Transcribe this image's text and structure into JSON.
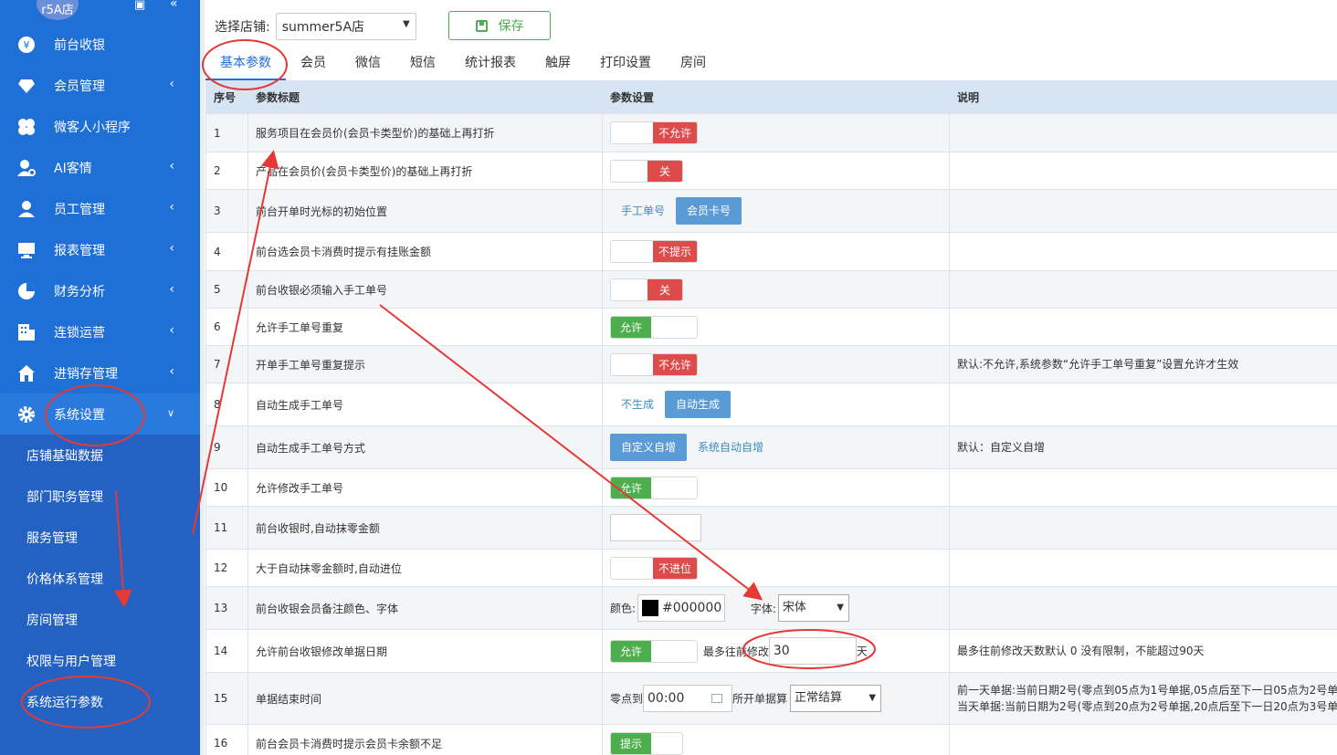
{
  "sidebar": {
    "store_badge": "r5A店",
    "menu": [
      {
        "label": "前台收银",
        "icon": "yen-icon"
      },
      {
        "label": "会员管理",
        "icon": "diamond-icon"
      },
      {
        "label": "微客人小程序",
        "icon": "flower-icon"
      },
      {
        "label": "AI客情",
        "icon": "user-ai-icon"
      },
      {
        "label": "员工管理",
        "icon": "user-icon"
      },
      {
        "label": "报表管理",
        "icon": "monitor-icon"
      },
      {
        "label": "财务分析",
        "icon": "pie-icon"
      },
      {
        "label": "连锁运营",
        "icon": "building-icon"
      },
      {
        "label": "进销存管理",
        "icon": "home-icon"
      },
      {
        "label": "系统设置",
        "icon": "gear-icon"
      }
    ],
    "submenu": [
      "店铺基础数据",
      "部门职务管理",
      "服务管理",
      "价格体系管理",
      "房间管理",
      "权限与用户管理",
      "系统运行参数"
    ]
  },
  "topbar": {
    "store_label": "选择店铺:",
    "store_value": "summer5A店",
    "save_label": "保存"
  },
  "tabs": [
    "基本参数",
    "会员",
    "微信",
    "短信",
    "统计报表",
    "触屏",
    "打印设置",
    "房间"
  ],
  "table": {
    "headers": [
      "序号",
      "参数标题",
      "参数设置",
      "说明"
    ],
    "rows": [
      {
        "no": "1",
        "title": "服务项目在会员价(会员卡类型价)的基础上再打折",
        "value": "不允许",
        "desc": ""
      },
      {
        "no": "2",
        "title": "产品在会员价(会员卡类型价)的基础上再打折",
        "value": "关",
        "desc": ""
      },
      {
        "no": "3",
        "title": "前台开单时光标的初始位置",
        "opt_a": "手工单号",
        "opt_b": "会员卡号",
        "desc": ""
      },
      {
        "no": "4",
        "title": "前台选会员卡消费时提示有挂账金额",
        "value": "不提示",
        "desc": ""
      },
      {
        "no": "5",
        "title": "前台收银必须输入手工单号",
        "value": "关",
        "desc": ""
      },
      {
        "no": "6",
        "title": "允许手工单号重复",
        "value": "允许",
        "desc": ""
      },
      {
        "no": "7",
        "title": "开单手工单号重复提示",
        "value": "不允许",
        "desc": "默认:不允许,系统参数“允许手工单号重复”设置允许才生效"
      },
      {
        "no": "8",
        "title": "自动生成手工单号",
        "opt_a": "不生成",
        "opt_b": "自动生成",
        "desc": ""
      },
      {
        "no": "9",
        "title": "自动生成手工单号方式",
        "opt_a": "自定义自增",
        "opt_b": "系统自动自增",
        "desc": "默认：自定义自增"
      },
      {
        "no": "10",
        "title": "允许修改手工单号",
        "value": "允许",
        "desc": ""
      },
      {
        "no": "11",
        "title": "前台收银时,自动抹零金额",
        "desc": ""
      },
      {
        "no": "12",
        "title": "大于自动抹零金额时,自动进位",
        "value": "不进位",
        "desc": ""
      },
      {
        "no": "13",
        "title": "前台收银会员备注颜色、字体",
        "color_label": "颜色:",
        "color_value": "#000000",
        "font_label": "字体:",
        "font_value": "宋体",
        "desc": ""
      },
      {
        "no": "14",
        "title": "允许前台收银修改单据日期",
        "value": "允许",
        "days_label": "最多往前修改",
        "days_value": "30",
        "days_unit": "天",
        "desc": "最多往前修改天数默认 0 没有限制，不能超过90天"
      },
      {
        "no": "15",
        "title": "单据结束时间",
        "zero_label": "零点到",
        "zero_value": "00:00",
        "open_label": "所开单据算",
        "open_value": "正常结算",
        "desc_1": "前一天单据:当前日期2号(零点到05点为1号单据,05点后至下一日05点为2号单据",
        "desc_2": "当天单据:当前日期为2号(零点到20点为2号单据,20点后至下一日20点为3号单据"
      },
      {
        "no": "16",
        "title": "前台会员卡消费时提示会员卡余额不足",
        "value": "提示",
        "desc": ""
      }
    ]
  },
  "colors": {
    "sidebar": "#1e6fd6",
    "accent": "#1e6fd6",
    "red_toggle": "#dd4b4b",
    "green_toggle": "#4cae4c",
    "annotation": "#e53935"
  }
}
